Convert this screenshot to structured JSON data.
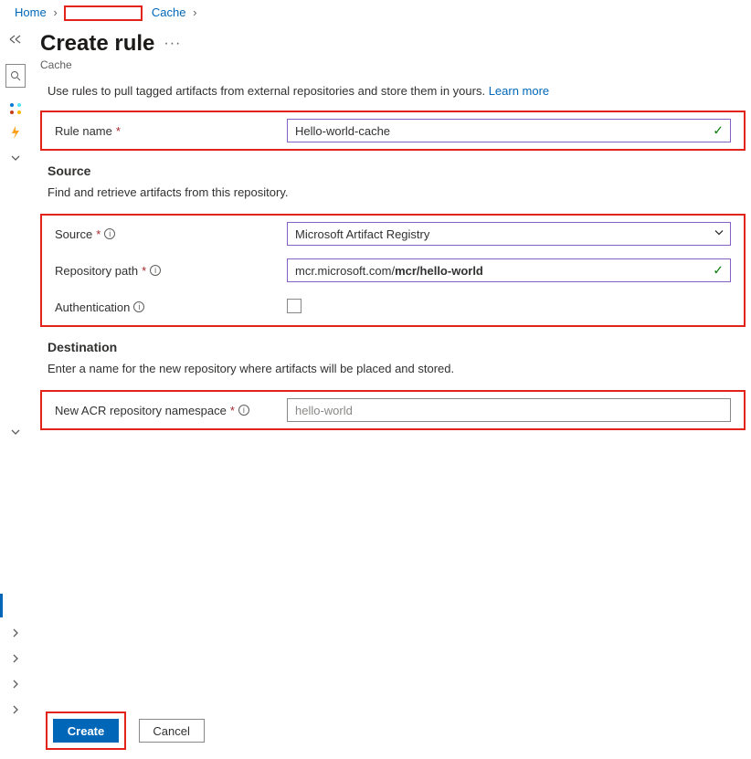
{
  "breadcrumb": {
    "home": "Home",
    "cache": "Cache"
  },
  "page": {
    "title": "Create rule",
    "subtitle": "Cache",
    "description_prefix": "Use rules to pull tagged artifacts from external repositories and store them in yours.",
    "learn_more": "Learn more"
  },
  "rule_name": {
    "label": "Rule name",
    "value": "Hello-world-cache"
  },
  "source_section": {
    "title": "Source",
    "subtitle": "Find and retrieve artifacts from this repository.",
    "source_label": "Source",
    "source_value": "Microsoft Artifact Registry",
    "repo_label": "Repository path",
    "repo_prefix": "mcr.microsoft.com/",
    "repo_value": "mcr/hello-world",
    "auth_label": "Authentication"
  },
  "destination_section": {
    "title": "Destination",
    "subtitle": "Enter a name for the new repository where artifacts will be placed and stored.",
    "ns_label": "New ACR repository namespace",
    "ns_value": "hello-world"
  },
  "buttons": {
    "create": "Create",
    "cancel": "Cancel"
  },
  "glyphs": {
    "chevron_right": "›",
    "chevron_right_small": "⟩",
    "info": "i",
    "ellipsis": "···"
  }
}
